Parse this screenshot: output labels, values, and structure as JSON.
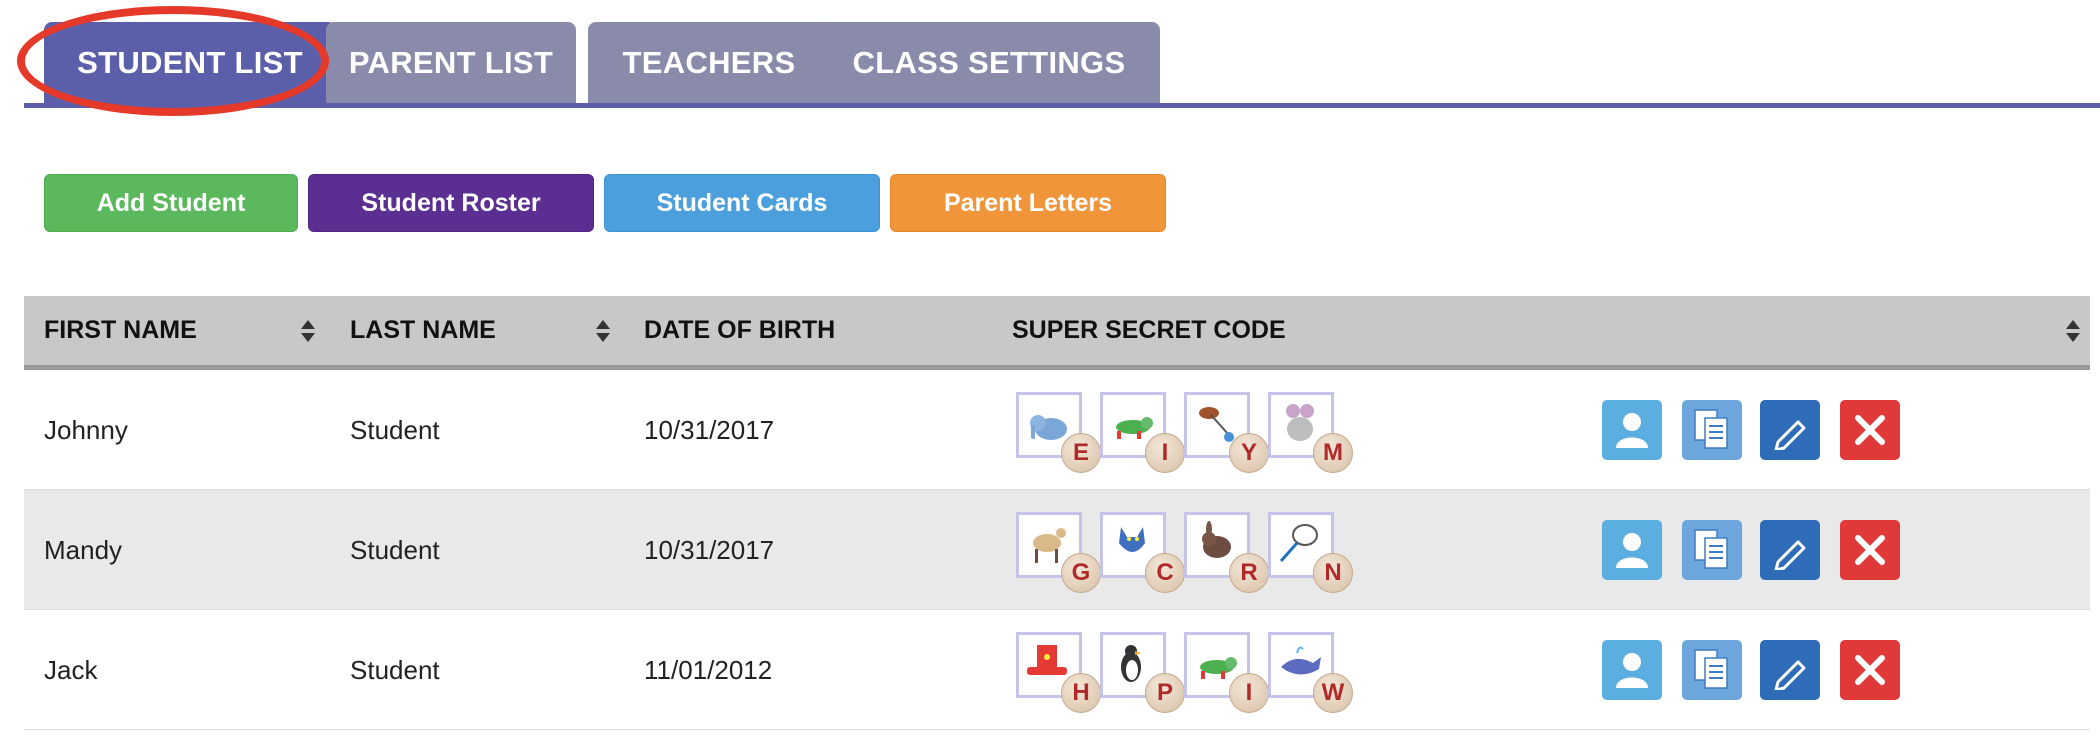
{
  "tabs": [
    {
      "label": "STUDENT LIST",
      "active": true
    },
    {
      "label": "PARENT LIST",
      "active": false
    },
    {
      "label": "TEACHERS",
      "active": false
    },
    {
      "label": "CLASS SETTINGS",
      "active": false
    }
  ],
  "actions": {
    "add_student": "Add Student",
    "student_roster": "Student Roster",
    "student_cards": "Student Cards",
    "parent_letters": "Parent Letters"
  },
  "table": {
    "headers": {
      "first_name": "FIRST NAME",
      "last_name": "LAST NAME",
      "dob": "DATE OF BIRTH",
      "code": "SUPER SECRET CODE"
    },
    "rows": [
      {
        "first": "Johnny",
        "last": "Student",
        "dob": "10/31/2017",
        "code": [
          {
            "icon": "elephant-icon",
            "letter": "E"
          },
          {
            "icon": "iguana-icon",
            "letter": "I"
          },
          {
            "icon": "yoyo-icon",
            "letter": "Y"
          },
          {
            "icon": "mouse-icon",
            "letter": "M"
          }
        ]
      },
      {
        "first": "Mandy",
        "last": "Student",
        "dob": "10/31/2017",
        "code": [
          {
            "icon": "goat-icon",
            "letter": "G"
          },
          {
            "icon": "cat-icon",
            "letter": "C"
          },
          {
            "icon": "rabbit-icon",
            "letter": "R"
          },
          {
            "icon": "net-icon",
            "letter": "N"
          }
        ]
      },
      {
        "first": "Jack",
        "last": "Student",
        "dob": "11/01/2012",
        "code": [
          {
            "icon": "hat-icon",
            "letter": "H"
          },
          {
            "icon": "penguin-icon",
            "letter": "P"
          },
          {
            "icon": "iguana-icon",
            "letter": "I"
          },
          {
            "icon": "whale-icon",
            "letter": "W"
          }
        ]
      }
    ]
  },
  "colors": {
    "tab_active": "#5b5ea8",
    "tab_inactive": "#8a8aaa",
    "highlight_ring": "#e53a2a",
    "btn_green": "#5cb85c",
    "btn_purple": "#5b2e92",
    "btn_blue": "#4a9fdc",
    "btn_orange": "#f0953a",
    "delete_red": "#e0393a"
  }
}
